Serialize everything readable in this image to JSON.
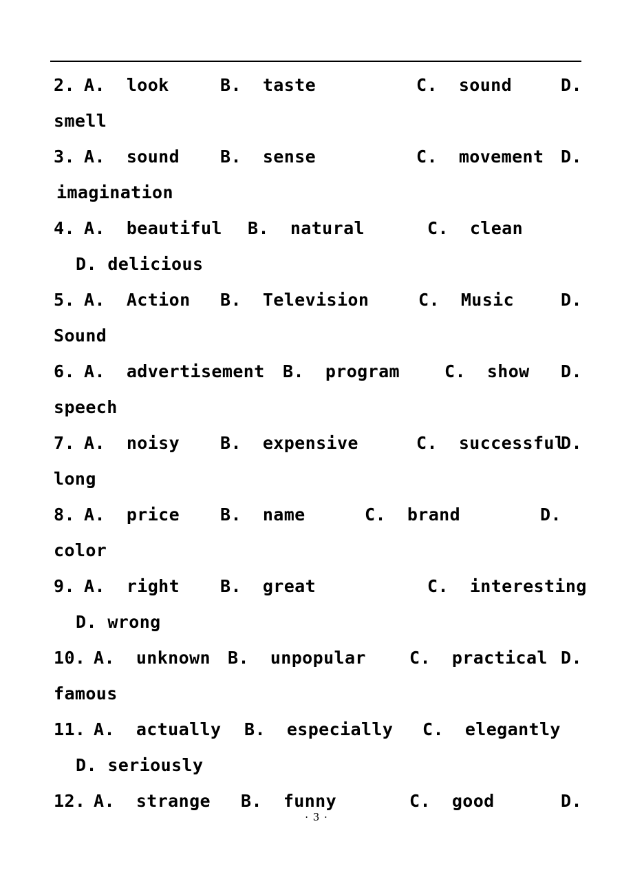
{
  "document": {
    "page_number_footer": "· 3 ·",
    "has_top_rule": true,
    "background_color": "#ffffff",
    "text_color": "#000000"
  },
  "questions": [
    {
      "number": "2.",
      "options": [
        {
          "label": "A.",
          "text": "look"
        },
        {
          "label": "B.",
          "text": "taste"
        },
        {
          "label": "C.",
          "text": "sound"
        },
        {
          "label": "D.",
          "text": "smell"
        }
      ],
      "wrapped_text": "smell",
      "wrap_style": "left-margin"
    },
    {
      "number": "3.",
      "options": [
        {
          "label": "A.",
          "text": "sound"
        },
        {
          "label": "B.",
          "text": "sense"
        },
        {
          "label": "C.",
          "text": "movement"
        },
        {
          "label": "D.",
          "text": "imagination"
        }
      ],
      "wrapped_text": "imagination",
      "wrap_style": "left-margin"
    },
    {
      "number": "4.",
      "options": [
        {
          "label": "A.",
          "text": "beautiful"
        },
        {
          "label": "B.",
          "text": "natural"
        },
        {
          "label": "C.",
          "text": "clean"
        },
        {
          "label": "D.",
          "text": "delicious"
        }
      ],
      "wrapped_text": "D.  delicious",
      "wrap_style": "indented"
    },
    {
      "number": "5.",
      "options": [
        {
          "label": "A.",
          "text": "Action"
        },
        {
          "label": "B.",
          "text": "Television"
        },
        {
          "label": "C.",
          "text": "Music"
        },
        {
          "label": "D.",
          "text": "Sound"
        }
      ],
      "wrapped_text": "Sound",
      "wrap_style": "left-margin"
    },
    {
      "number": "6.",
      "options": [
        {
          "label": "A.",
          "text": "advertisement"
        },
        {
          "label": "B.",
          "text": "program"
        },
        {
          "label": "C.",
          "text": "show"
        },
        {
          "label": "D.",
          "text": "speech"
        }
      ],
      "wrapped_text": "speech",
      "wrap_style": "left-margin"
    },
    {
      "number": "7.",
      "options": [
        {
          "label": "A.",
          "text": "noisy"
        },
        {
          "label": "B.",
          "text": "expensive"
        },
        {
          "label": "C.",
          "text": "successful"
        },
        {
          "label": "D.",
          "text": "long"
        }
      ],
      "wrapped_text": "long",
      "wrap_style": "left-margin"
    },
    {
      "number": "8.",
      "options": [
        {
          "label": "A.",
          "text": "price"
        },
        {
          "label": "B.",
          "text": "name"
        },
        {
          "label": "C.",
          "text": "brand"
        },
        {
          "label": "D.",
          "text": "color"
        }
      ],
      "wrapped_text": "color",
      "wrap_style": "left-margin"
    },
    {
      "number": "9.",
      "options": [
        {
          "label": "A.",
          "text": "right"
        },
        {
          "label": "B.",
          "text": "great"
        },
        {
          "label": "C.",
          "text": "interesting"
        },
        {
          "label": "D.",
          "text": "wrong"
        }
      ],
      "wrapped_text": "D.  wrong",
      "wrap_style": "indented"
    },
    {
      "number": "10.",
      "options": [
        {
          "label": "A.",
          "text": "unknown"
        },
        {
          "label": "B.",
          "text": "unpopular"
        },
        {
          "label": "C.",
          "text": "practical"
        },
        {
          "label": "D.",
          "text": "famous"
        }
      ],
      "wrapped_text": "famous",
      "wrap_style": "left-margin"
    },
    {
      "number": "11.",
      "options": [
        {
          "label": "A.",
          "text": "actually"
        },
        {
          "label": "B.",
          "text": "especially"
        },
        {
          "label": "C.",
          "text": "elegantly"
        },
        {
          "label": "D.",
          "text": "seriously"
        }
      ],
      "wrapped_text": "D.  seriously",
      "wrap_style": "indented"
    },
    {
      "number": "12.",
      "options": [
        {
          "label": "A.",
          "text": "strange"
        },
        {
          "label": "B.",
          "text": "funny"
        },
        {
          "label": "C.",
          "text": "good"
        },
        {
          "label": "D.",
          "text": ""
        }
      ],
      "wrapped_text": "",
      "wrap_style": "cut-off"
    }
  ]
}
